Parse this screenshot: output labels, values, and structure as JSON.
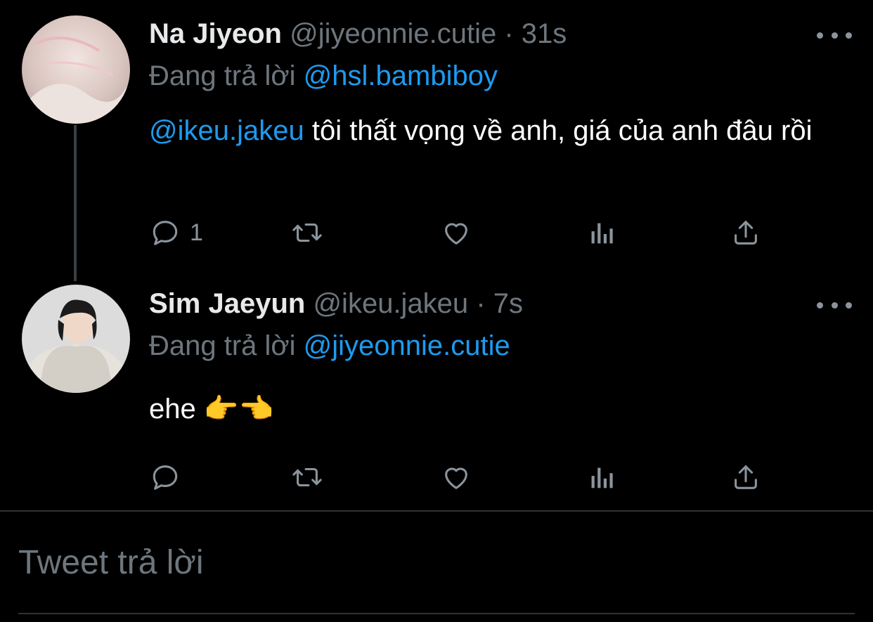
{
  "tweets": [
    {
      "name": "Na Jiyeon",
      "handle": "@jiyeonnie.cutie",
      "sep": "·",
      "time": "31s",
      "replying_prefix": "Đang trả lời",
      "replying_to": "@hsl.bambiboy",
      "mention": "@ikeu.jakeu",
      "text": "tôi thất vọng về anh, giá của anh đâu rồi",
      "reply_count": "1"
    },
    {
      "name": "Sim Jaeyun",
      "handle": "@ikeu.jakeu",
      "sep": "·",
      "time": "7s",
      "replying_prefix": "Đang trả lời",
      "replying_to": "@jiyeonnie.cutie",
      "text": "ehe 👉👈",
      "reply_count": ""
    }
  ],
  "compose": {
    "placeholder": "Tweet trả lời"
  },
  "icons": [
    "reply-icon",
    "retweet-icon",
    "like-icon",
    "analytics-icon",
    "share-icon",
    "more-icon"
  ],
  "colors": {
    "background": "#000000",
    "link": "#1d9bf0",
    "muted": "#6e767d",
    "text": "#ffffff"
  }
}
